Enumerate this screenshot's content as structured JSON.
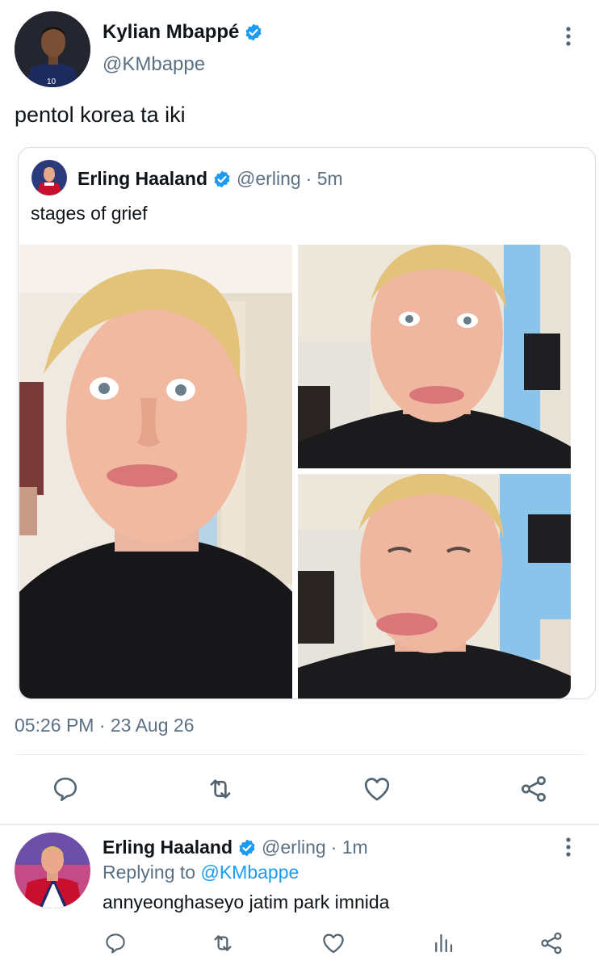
{
  "tweet": {
    "author_name": "Kylian Mbappé",
    "author_handle": "@KMbappe",
    "text": "pentol korea ta iki",
    "timestamp": "05:26 PM · 23 Aug 26",
    "verified": true
  },
  "quoted_tweet": {
    "author_name": "Erling Haaland",
    "author_handle": "@erling",
    "time": "· 5m",
    "text": "stages of grief",
    "photo_count": 3,
    "verified": true
  },
  "reply": {
    "author_name": "Erling Haaland",
    "author_handle": "@erling",
    "time": "· 1m",
    "replying_prefix": "Replying to",
    "replying_mention": "@KMbappe",
    "text": "annyeonghaseyo jatim park imnida",
    "verified": true
  },
  "icons": {
    "more": "more-vertical-icon",
    "reply": "reply-bubble-icon",
    "retweet": "retweet-icon",
    "like": "heart-icon",
    "share": "share-icon",
    "views": "views-chart-icon",
    "verified": "verified-badge-icon"
  },
  "colors": {
    "accent": "#1d9bf0",
    "secondary_text": "#5b7083",
    "icon_gray": "#536471",
    "divider": "#e6ecf0"
  }
}
